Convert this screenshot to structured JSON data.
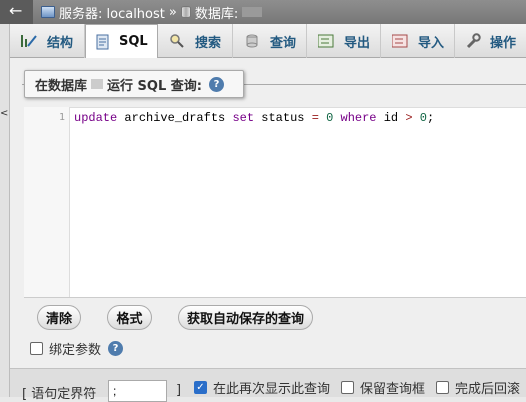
{
  "breadcrumb": {
    "server_label": "服务器: localhost",
    "separator": "»",
    "database_label": "数据库:"
  },
  "tabs": [
    {
      "label": "结构",
      "icon": "structure-icon"
    },
    {
      "label": "SQL",
      "icon": "sql-icon",
      "active": true
    },
    {
      "label": "搜索",
      "icon": "search-icon"
    },
    {
      "label": "查询",
      "icon": "query-icon"
    },
    {
      "label": "导出",
      "icon": "export-icon"
    },
    {
      "label": "导入",
      "icon": "import-icon"
    },
    {
      "label": "操作",
      "icon": "operations-icon"
    }
  ],
  "sql_panel": {
    "legend_prefix": "在数据库",
    "legend_suffix": "运行 SQL 查询:",
    "line_number": "1",
    "query": "update archive_drafts set status = 0 where id > 0;"
  },
  "buttons": {
    "clear": "清除",
    "format": "格式",
    "autosave": "获取自动保存的查询"
  },
  "bind_params_label": "绑定参数",
  "footer": {
    "delimiter_label": "[ 语句定界符",
    "delimiter_value": ";",
    "delimiter_close": "]",
    "show_again_label": "在此再次显示此查询",
    "show_again_checked": true,
    "retain_box_label": "保留查询框",
    "retain_box_checked": false,
    "rollback_label": "完成后回滚",
    "rollback_checked": false
  }
}
